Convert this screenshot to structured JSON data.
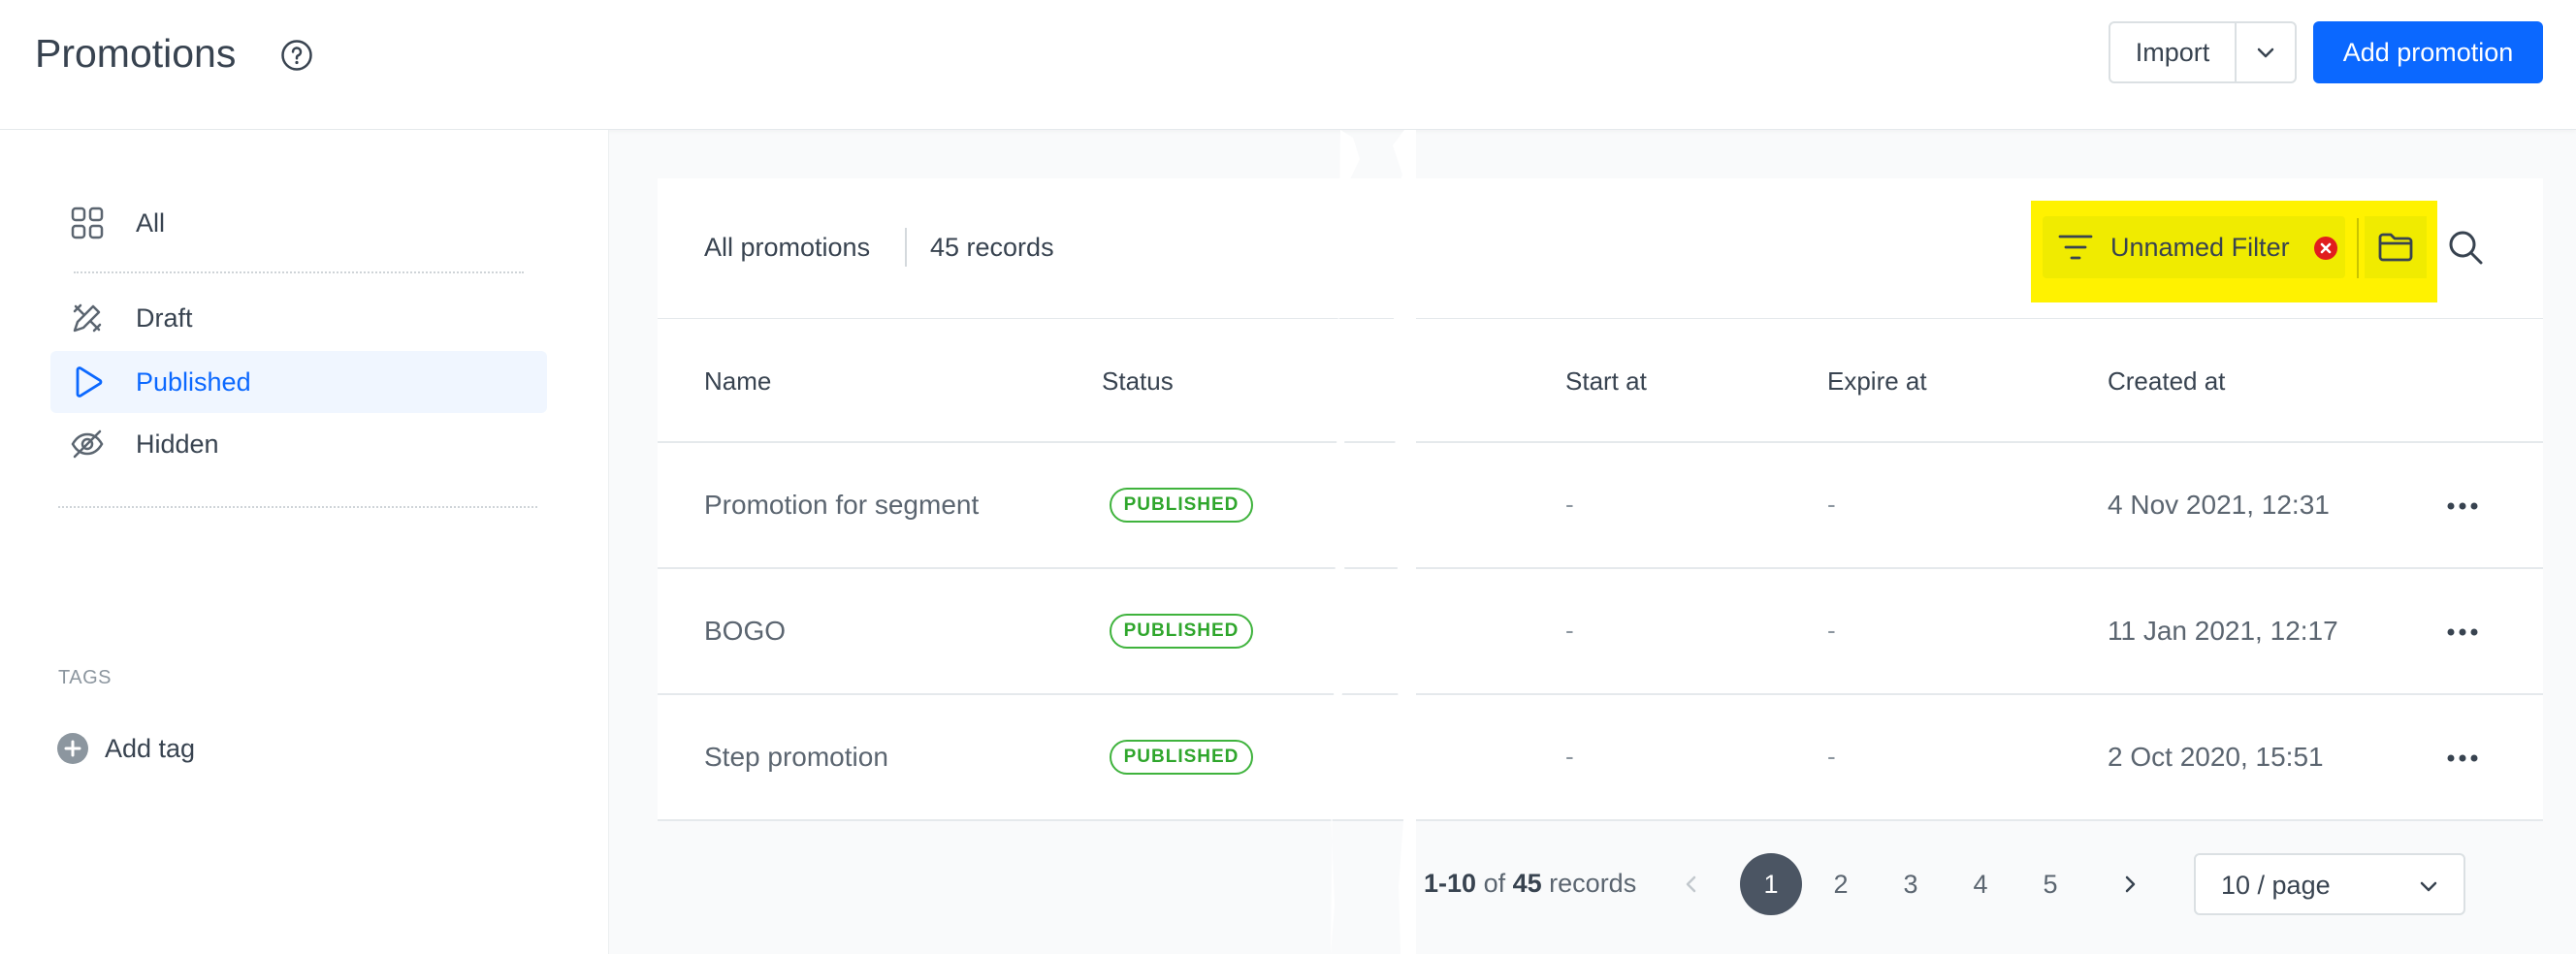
{
  "header": {
    "title": "Promotions",
    "import_label": "Import",
    "add_label": "Add promotion"
  },
  "sidebar": {
    "items": [
      {
        "label": "All",
        "icon": "grid-icon"
      },
      {
        "label": "Draft",
        "icon": "pencil-ruler-icon"
      },
      {
        "label": "Published",
        "icon": "play-icon",
        "active": true
      },
      {
        "label": "Hidden",
        "icon": "eye-off-icon"
      }
    ],
    "tags_title": "TAGS",
    "add_tag_label": "Add tag"
  },
  "list": {
    "title": "All promotions",
    "count": "45 records",
    "filter_label": "Unnamed Filter",
    "columns": [
      "Name",
      "Status",
      "Start at",
      "Expire at",
      "Created at"
    ],
    "rows": [
      {
        "name": "Promotion for segment",
        "status": "PUBLISHED",
        "start": "-",
        "expire": "-",
        "created": "4 Nov 2021, 12:31"
      },
      {
        "name": "BOGO",
        "status": "PUBLISHED",
        "start": "-",
        "expire": "-",
        "created": "11 Jan 2021, 12:17"
      },
      {
        "name": "Step promotion",
        "status": "PUBLISHED",
        "start": "-",
        "expire": "-",
        "created": "2 Oct 2020, 15:51"
      }
    ]
  },
  "pagination": {
    "range": "1-10",
    "of": "of",
    "total": "45",
    "records_word": "records",
    "pages": [
      "1",
      "2",
      "3",
      "4",
      "5"
    ],
    "current": "1",
    "page_size": "10 / page"
  },
  "colors": {
    "accent": "#0b68ff",
    "highlight": "#fff200",
    "published": "#2fa62c",
    "clear": "#e11d1d"
  }
}
